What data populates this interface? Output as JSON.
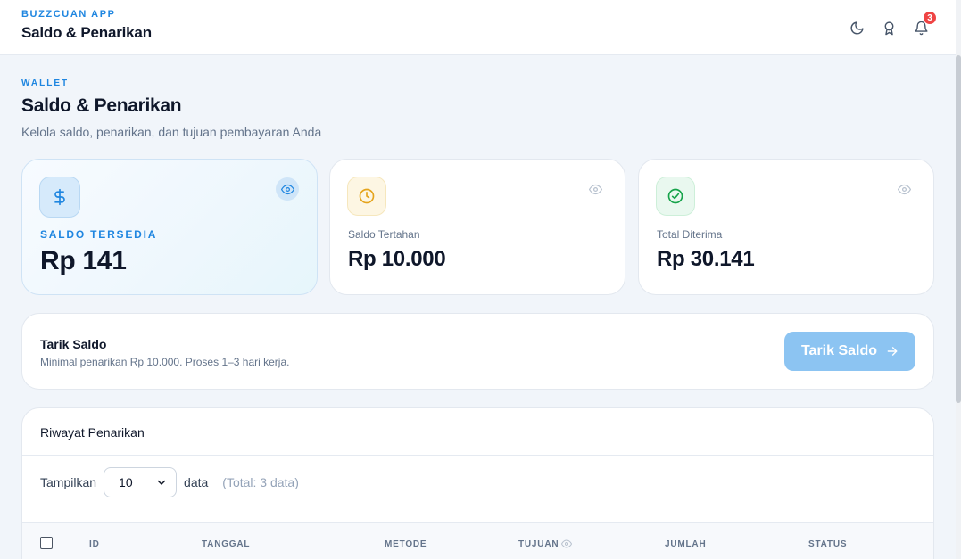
{
  "header": {
    "brand": "BUZZCUAN APP",
    "title": "Saldo & Penarikan",
    "icons": [
      "moon-icon",
      "award-icon",
      "bell-icon"
    ],
    "notification_count": "3"
  },
  "page": {
    "eyebrow": "WALLET",
    "title": "Saldo & Penarikan",
    "subtitle": "Kelola saldo, penarikan, dan tujuan pembayaran Anda"
  },
  "stats": [
    {
      "label": "SALDO TERSEDIA",
      "value": "Rp 141",
      "icon": "dollar-icon",
      "color": "#1f86e0"
    },
    {
      "label": "Saldo Tertahan",
      "value": "Rp 10.000",
      "icon": "clock-icon",
      "color": "#e5a41c"
    },
    {
      "label": "Total Diterima",
      "value": "Rp 30.141",
      "icon": "check-circle-icon",
      "color": "#16a34a"
    }
  ],
  "withdraw": {
    "title": "Tarik Saldo",
    "subtitle": "Minimal penarikan Rp 10.000. Proses 1–3 hari kerja.",
    "button_label": "Tarik Saldo"
  },
  "history": {
    "title": "Riwayat Penarikan",
    "show_label": "Tampilkan",
    "page_size": "10",
    "data_label": "data",
    "total_label": "(Total: 3 data)",
    "columns": [
      "ID",
      "TANGGAL",
      "METODE",
      "TUJUAN",
      "JUMLAH",
      "STATUS"
    ]
  },
  "colors": {
    "accent": "#1f86e0",
    "button": "#8cc4f2",
    "badge": "#ef4444"
  }
}
